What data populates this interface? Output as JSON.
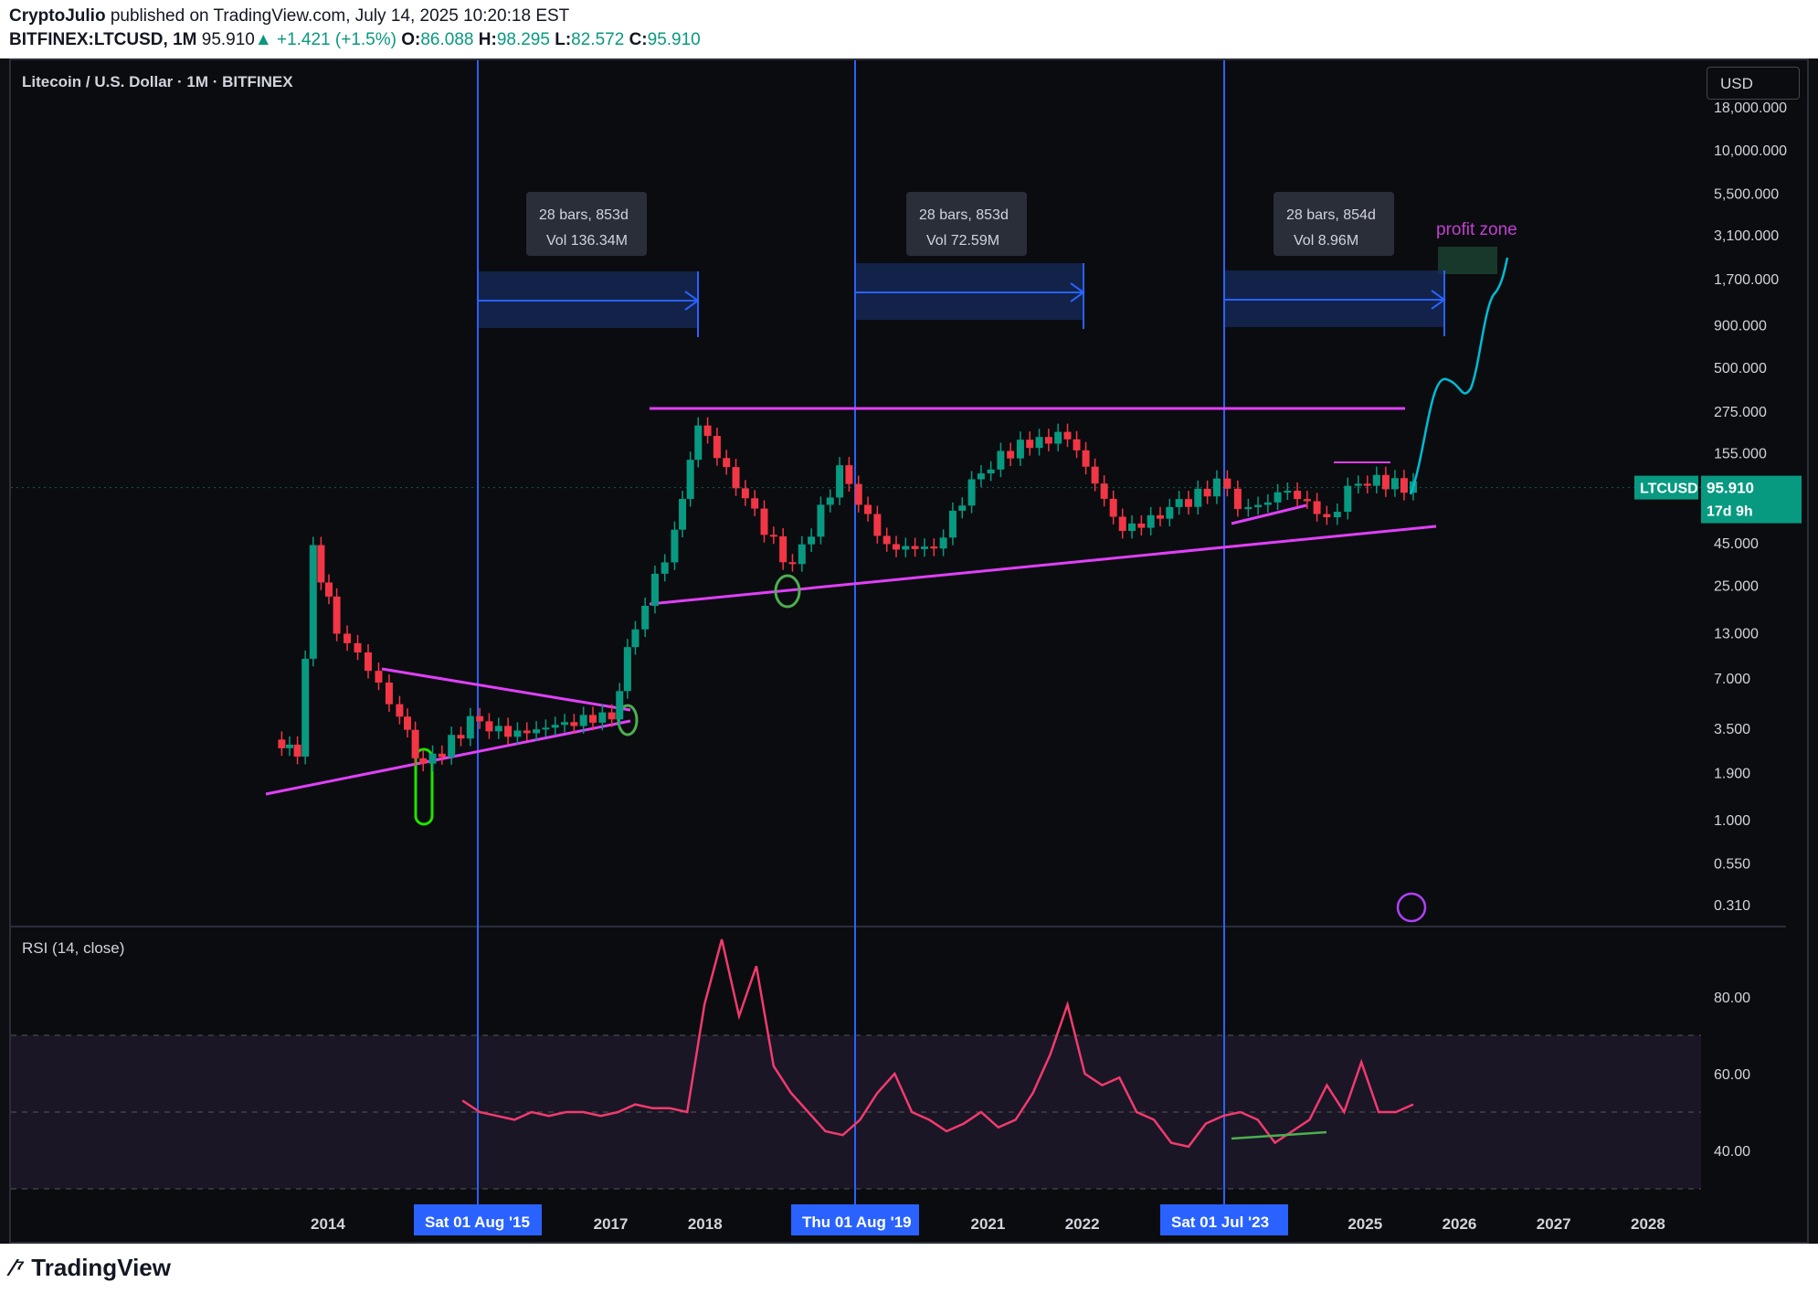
{
  "header": {
    "author": "CryptoJulio",
    "published": "published on TradingView.com, July 14, 2025 10:20:18 EST",
    "symbol": "BITFINEX:LTCUSD, 1M",
    "last": "95.910",
    "change": "+1.421 (+1.5%)",
    "open_label": "O:",
    "open": "86.088",
    "high_label": "H:",
    "high": "98.295",
    "low_label": "L:",
    "low": "82.572",
    "close_label": "C:",
    "close": "95.910"
  },
  "chart_title": "Litecoin / U.S. Dollar · 1M · BITFINEX",
  "currency_button": "USD",
  "price_tag": {
    "symbol": "LTCUSD",
    "price": "95.910",
    "countdown": "17d 9h"
  },
  "brand": "TradingView",
  "colors": {
    "up": "#089981",
    "down": "#f23645",
    "accent": "#2962ff",
    "magenta": "#e040fb",
    "rsi": "#f23a6e",
    "cyan": "#00bcd4"
  },
  "chart_data": [
    {
      "type": "candlestick",
      "scale": "log",
      "title": "Litecoin / U.S. Dollar · 1M · BITFINEX",
      "y_ticks": [
        "18,000.000",
        "10,000.000",
        "5,500.000",
        "3,100.000",
        "1,700.000",
        "900.000",
        "500.000",
        "275.000",
        "155.000",
        "95.910",
        "45.000",
        "25.000",
        "13.000",
        "7.000",
        "3.500",
        "1.900",
        "1.000",
        "0.550",
        "0.310"
      ],
      "x_ticks": [
        "2014",
        "2017",
        "2018",
        "2021",
        "2022",
        "2025",
        "2026",
        "2027",
        "2028"
      ],
      "date_markers": [
        "Sat 01 Aug '15",
        "Thu 01 Aug '19",
        "Sat 01 Jul '23"
      ],
      "close_series_approx": [
        {
          "x": "2013-06",
          "y": 3.0
        },
        {
          "x": "2013-09",
          "y": 2.5
        },
        {
          "x": "2013-11",
          "y": 40
        },
        {
          "x": "2014-02",
          "y": 14
        },
        {
          "x": "2014-06",
          "y": 8
        },
        {
          "x": "2014-10",
          "y": 4
        },
        {
          "x": "2015-01",
          "y": 2.0
        },
        {
          "x": "2015-07",
          "y": 3.8
        },
        {
          "x": "2016-01",
          "y": 3.2
        },
        {
          "x": "2016-07",
          "y": 3.8
        },
        {
          "x": "2017-01",
          "y": 4.2
        },
        {
          "x": "2017-04",
          "y": 15
        },
        {
          "x": "2017-09",
          "y": 50
        },
        {
          "x": "2017-12",
          "y": 230
        },
        {
          "x": "2018-06",
          "y": 80
        },
        {
          "x": "2018-12",
          "y": 31
        },
        {
          "x": "2019-06",
          "y": 120
        },
        {
          "x": "2019-12",
          "y": 42
        },
        {
          "x": "2020-06",
          "y": 42
        },
        {
          "x": "2020-12",
          "y": 125
        },
        {
          "x": "2021-05",
          "y": 170
        },
        {
          "x": "2021-11",
          "y": 200
        },
        {
          "x": "2022-06",
          "y": 52
        },
        {
          "x": "2022-12",
          "y": 70
        },
        {
          "x": "2023-06",
          "y": 100
        },
        {
          "x": "2023-10",
          "y": 68
        },
        {
          "x": "2024-03",
          "y": 95
        },
        {
          "x": "2024-08",
          "y": 62
        },
        {
          "x": "2024-12",
          "y": 110
        },
        {
          "x": "2025-07",
          "y": 95.91
        }
      ],
      "measure_boxes": [
        {
          "bars": "28 bars, 853d",
          "vol": "Vol 136.34M"
        },
        {
          "bars": "28 bars, 853d",
          "vol": "Vol 72.59M"
        },
        {
          "bars": "28 bars, 854d",
          "vol": "Vol 8.96M"
        }
      ],
      "annotations": [
        "profit zone"
      ]
    },
    {
      "type": "line",
      "title": "RSI (14, close)",
      "y_ticks": [
        "80.00",
        "60.00",
        "40.00"
      ],
      "bands": [
        30,
        50,
        70
      ],
      "series": [
        {
          "values_approx": [
            53,
            50,
            49,
            48,
            50,
            49,
            50,
            50,
            49,
            50,
            52,
            51,
            51,
            50,
            78,
            95,
            75,
            88,
            62,
            55,
            50,
            45,
            44,
            48,
            55,
            60,
            50,
            48,
            45,
            47,
            50,
            46,
            48,
            55,
            65,
            78,
            60,
            57,
            59,
            50,
            48,
            42,
            41,
            47,
            49,
            50,
            48,
            42,
            45,
            48,
            57,
            50,
            63,
            50,
            50,
            52
          ]
        }
      ]
    }
  ]
}
